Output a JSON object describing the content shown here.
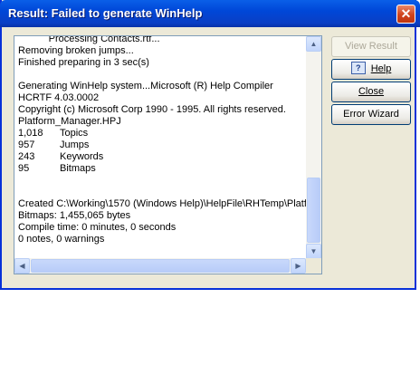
{
  "window": {
    "title": "Result: Failed to generate WinHelp",
    "close_glyph": "✕"
  },
  "output": {
    "lines": [
      {
        "text": "           Processing Contacts.rtf..."
      },
      {
        "text": "Removing broken jumps..."
      },
      {
        "text": "Finished preparing in 3 sec(s)"
      },
      {
        "text": ""
      },
      {
        "text": "Generating WinHelp system...Microsoft (R) Help Compiler"
      },
      {
        "text": "HCRTF 4.03.0002"
      },
      {
        "text": "Copyright (c) Microsoft Corp 1990 - 1995. All rights reserved."
      },
      {
        "text": "Platform_Manager.HPJ"
      },
      {
        "count": "1,018",
        "label": "Topics"
      },
      {
        "count": "957",
        "label": "Jumps"
      },
      {
        "count": "243",
        "label": "Keywords"
      },
      {
        "count": "95",
        "label": "Bitmaps"
      },
      {
        "text": ""
      },
      {
        "text": ""
      },
      {
        "text": "Created C:\\Working\\1570 (Windows Help)\\HelpFile\\RHTemp\\Platf"
      },
      {
        "text": "Bitmaps: 1,455,065 bytes"
      },
      {
        "text": "Compile time: 0 minutes, 0 seconds"
      },
      {
        "text": "0 notes, 0 warnings"
      }
    ]
  },
  "scrollbars": {
    "vertical": {
      "up_glyph": "▲",
      "down_glyph": "▼"
    },
    "horizontal": {
      "left_glyph": "◀",
      "right_glyph": "▶"
    }
  },
  "buttons": {
    "view_result": {
      "label": "View Result",
      "enabled": false
    },
    "help": {
      "icon_glyph": "?",
      "label": "Help",
      "enabled": true
    },
    "close": {
      "label": "Close",
      "enabled": true
    },
    "error_wizard": {
      "label": "Error Wizard",
      "enabled": true
    }
  },
  "colors": {
    "titlebar": "#0a5fe8",
    "window_border": "#0831d9",
    "dialog_face": "#ece9d8",
    "close_button": "#d0431b"
  }
}
